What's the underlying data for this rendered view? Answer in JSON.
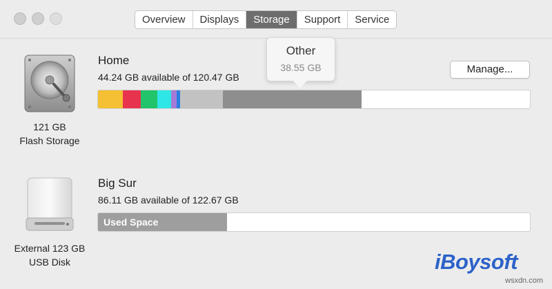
{
  "tabs": [
    {
      "label": "Overview"
    },
    {
      "label": "Displays"
    },
    {
      "label": "Storage",
      "active": true
    },
    {
      "label": "Support"
    },
    {
      "label": "Service"
    }
  ],
  "drives": [
    {
      "caption_line1": "121 GB",
      "caption_line2": "Flash Storage",
      "icon": "hard-drive-icon",
      "volume_name": "Home",
      "available_text": "44.24 GB available of 120.47 GB",
      "manage_label": "Manage...",
      "usage_segments": [
        {
          "category": "yellow",
          "color": "#f5c033",
          "gb": 7.0
        },
        {
          "category": "red",
          "color": "#e8334f",
          "gb": 5.0
        },
        {
          "category": "green",
          "color": "#21c46a",
          "gb": 4.5
        },
        {
          "category": "cyan",
          "color": "#2ee6e6",
          "gb": 4.0
        },
        {
          "category": "purple",
          "color": "#a37bd6",
          "gb": 1.4
        },
        {
          "category": "blue",
          "color": "#2a7de1",
          "gb": 1.0
        },
        {
          "category": "light-gray",
          "color": "#c2c2c2",
          "gb": 12.0
        },
        {
          "category": "Other",
          "color": "#8e8e8e",
          "gb": 38.55
        }
      ],
      "tooltip": {
        "title": "Other",
        "value": "38.55 GB"
      }
    },
    {
      "caption_line1": "External 123 GB",
      "caption_line2": "USB Disk",
      "icon": "usb-disk-icon",
      "volume_name": "Big Sur",
      "available_text": "86.11 GB available of 122.67 GB",
      "used_label": "Used Space",
      "used_fraction": 0.298
    }
  ],
  "watermark": {
    "brand": "iBoysoft",
    "site": "wsxdn.com"
  }
}
